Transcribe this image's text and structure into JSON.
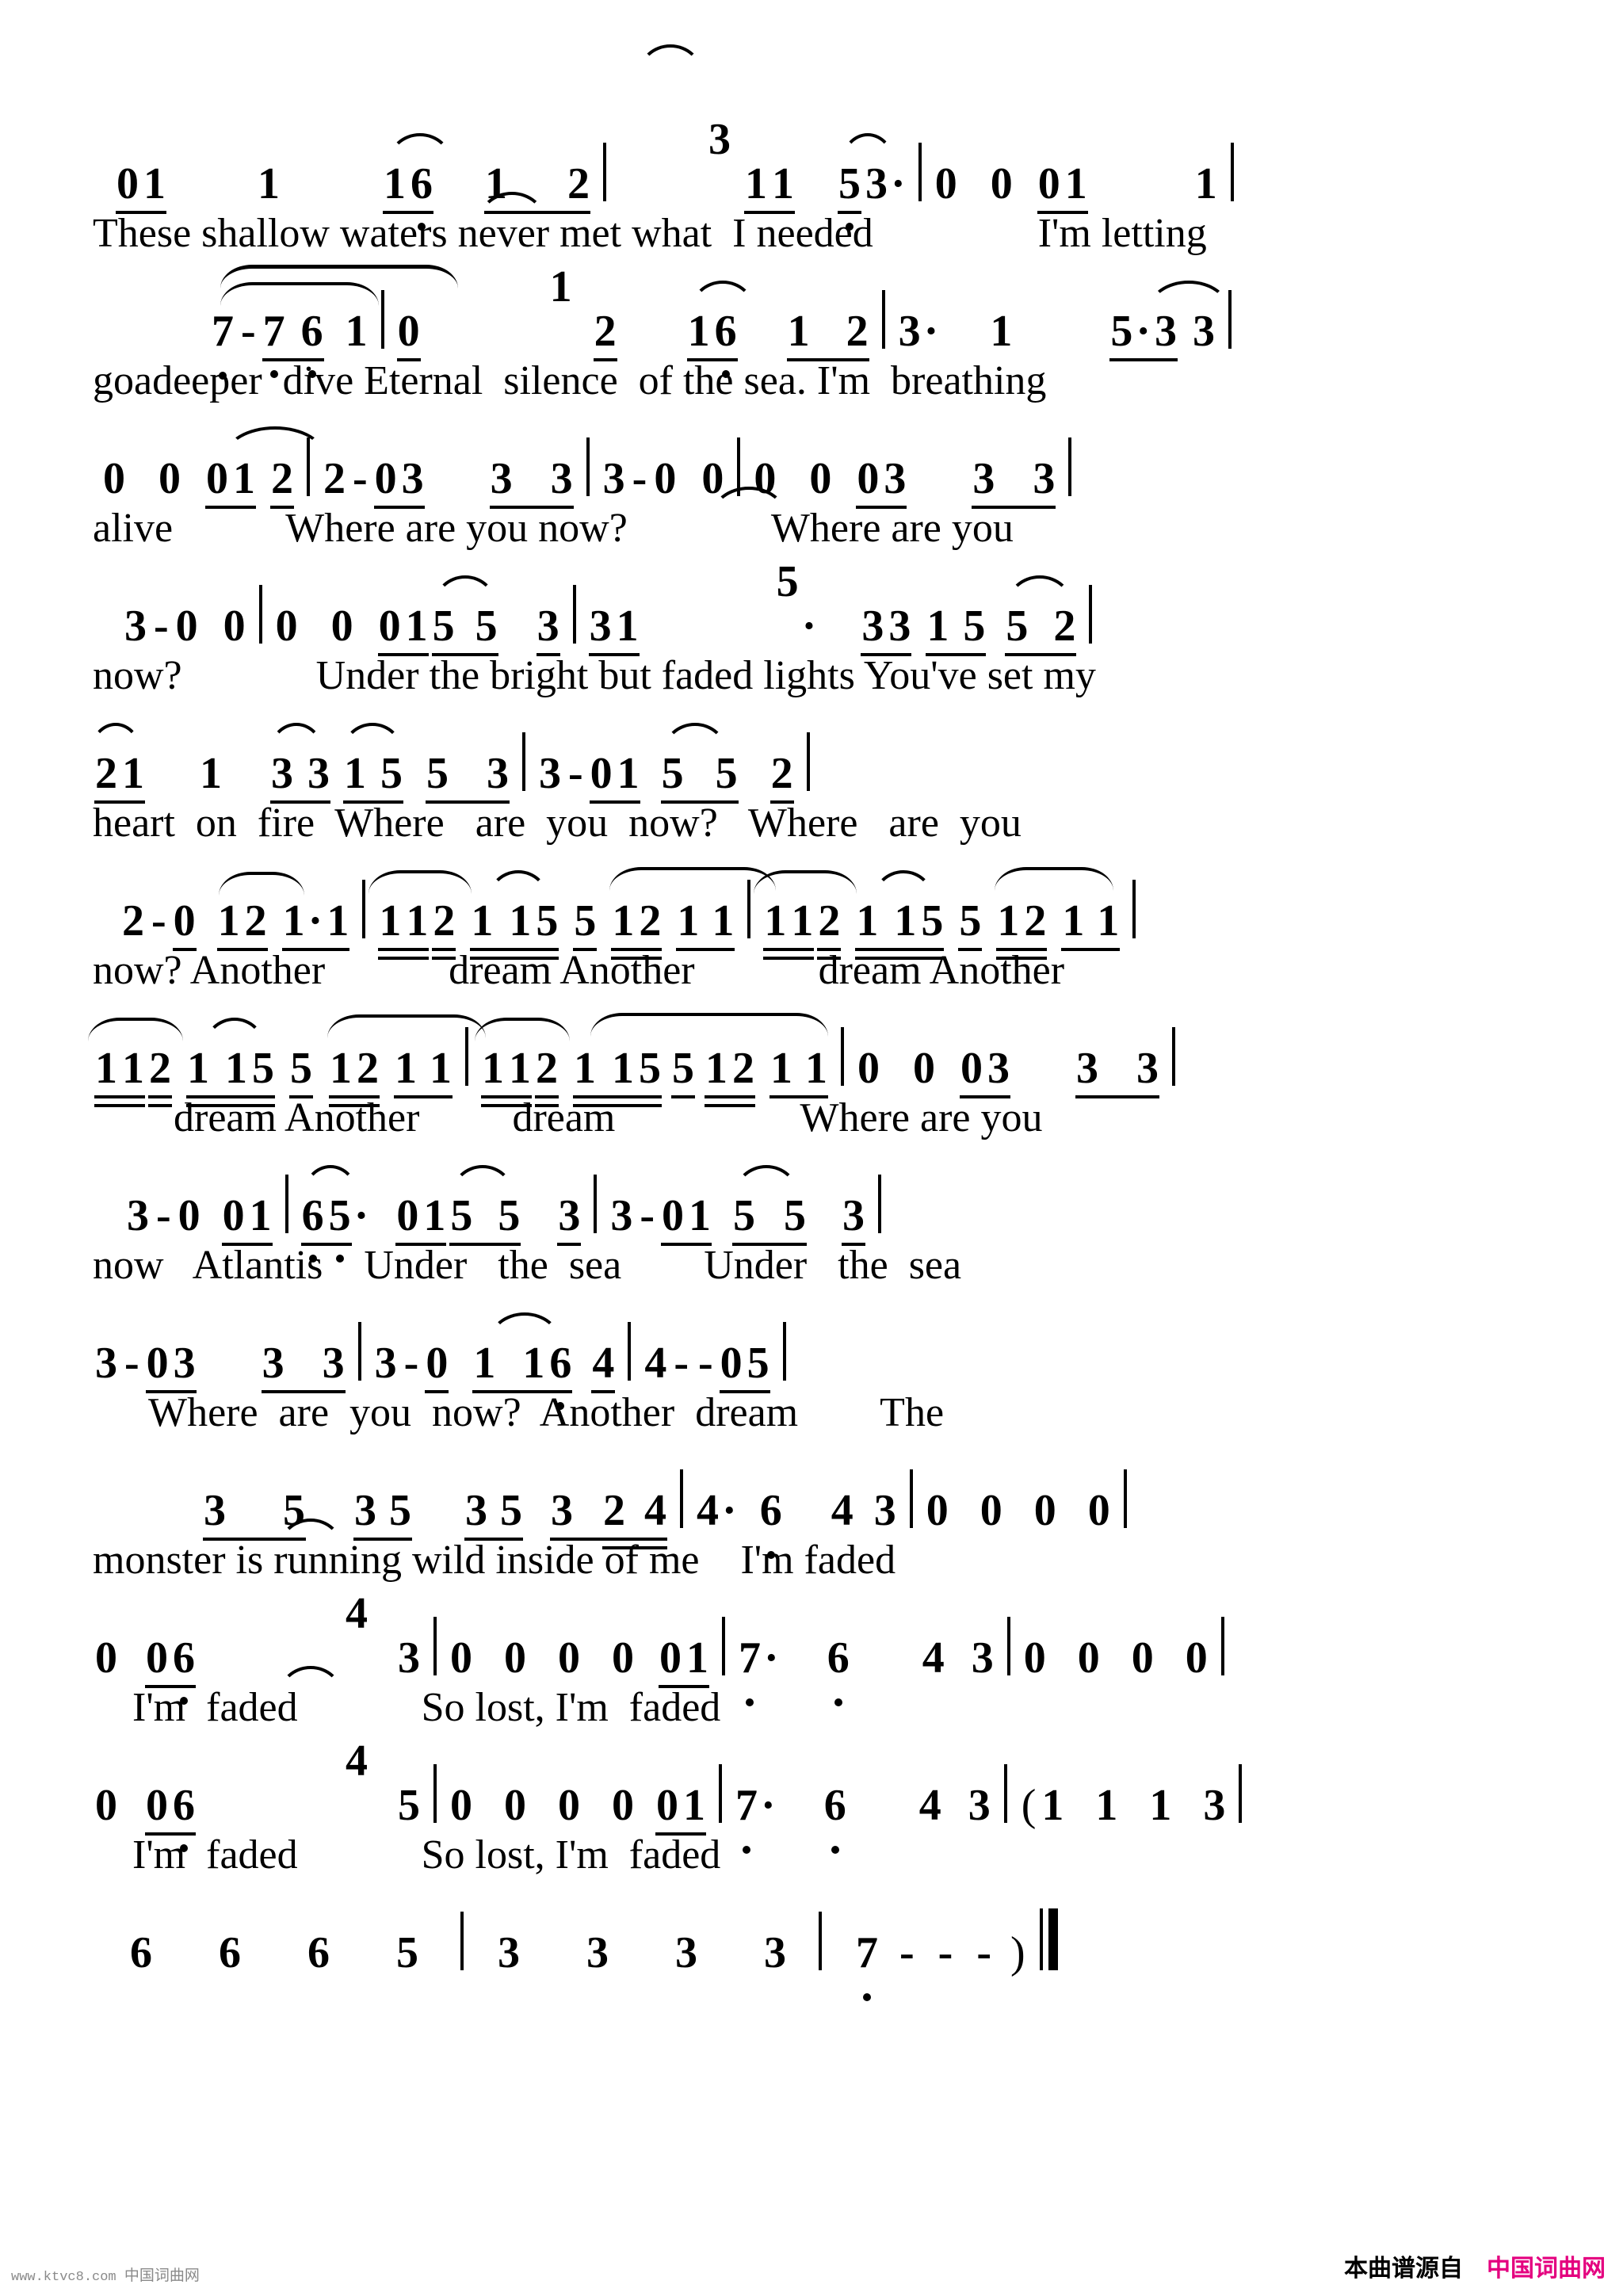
{
  "document": {
    "kind": "numbered-musical-notation-sheet",
    "watermark_left_url": "www.ktvc8.com",
    "watermark_left_cn": "中国词曲网",
    "watermark_right_prefix": "本曲谱源自",
    "watermark_right_site": "中国词曲网",
    "watermark_right_color": "#e4007f"
  },
  "systems": [
    {
      "id": "system-1",
      "notation": "0 1    1      1 6   1   2 | 3 1 1   5 3· | 0  0  0 1      1 |",
      "lyrics": "These shallow waters never met what  I needed                I'm letting"
    },
    {
      "id": "system-2",
      "notation": "7 - 7 6 1 | 0  1  2    1 6   1  2 | 3·  1      5·3 3 |",
      "lyrics": "goadeeper  dive Eternal  silence  of the sea. I'm  breathing"
    },
    {
      "id": "system-3",
      "notation": "0  0  0 1  2 | 2 - 0 3    3  3 | 3 - 0  0 | 0  0  0 3    3  3 |",
      "lyrics": "alive           Where are you now?              Where are you"
    },
    {
      "id": "system-4",
      "notation": "3 - 0 0 | 0  0  0 1 5  5   3 | 3 1   5·   3 3   1 5  5   2 |",
      "lyrics": "now?             Under the bright but faded lights You've set my"
    },
    {
      "id": "system-5",
      "notation": "2 1    1   3  3   1 5   5   3 | 3 - 0 1  5   5   2 |",
      "lyrics": "heart  on  fire  Where   are  you  now?   Where   are  you"
    },
    {
      "id": "system-6",
      "notation": "2 - 0  1 2  1·1 | 1 1 2  1 1 5 5  1 2  1 1 | 1 1 2  1 1 5 5  1 2  1 1 |",
      "lyrics": "now? Another            dream Another            dream Another"
    },
    {
      "id": "system-7",
      "notation": "1 1 2  1 1 5  5  1 2  1 1 | 1 1 2  1 1 5 5 1 2  1 1 | 0  0  0 3     3  3 |",
      "lyrics": "dream Another         dream                  Where are you"
    },
    {
      "id": "system-8",
      "notation": "3 - 0  0 1 | 6 5·  0 1  5   5   3 | 3 - 0 1  5   5   3 |",
      "lyrics": "now   Atlantis    Under   the  sea        Under   the  sea"
    },
    {
      "id": "system-9",
      "notation": "3 - 0 3    3  3 | 3 - 0  1  1 6   4 | 4 - - 0 5 |",
      "lyrics": "Where  are  you  now?  Another  dream        The"
    },
    {
      "id": "system-10",
      "notation": "3   5    3 5    3 5   3  2 4 | 4· 6   4 3 | 0 0 0 0 |",
      "lyrics": "monster is running wild inside of me    I'm faded"
    },
    {
      "id": "system-11",
      "notation": "0  0 6    4  3 | 0  0  0  0  0 1 | 7·  6     4 3 | 0  0  0  0 |",
      "lyrics": "I'm  faded            So lost, I'm  faded"
    },
    {
      "id": "system-12",
      "notation": "0  0 6    4  5 | 0  0  0  0 0 1 | 7·  6     4 3 | ( 1  1  1  3 |",
      "lyrics": "I'm  faded            So lost, I'm  faded"
    },
    {
      "id": "system-13",
      "notation": "6    6    6    5  | 3    3    3   3 | 7 - - - ) ||",
      "lyrics": ""
    }
  ]
}
